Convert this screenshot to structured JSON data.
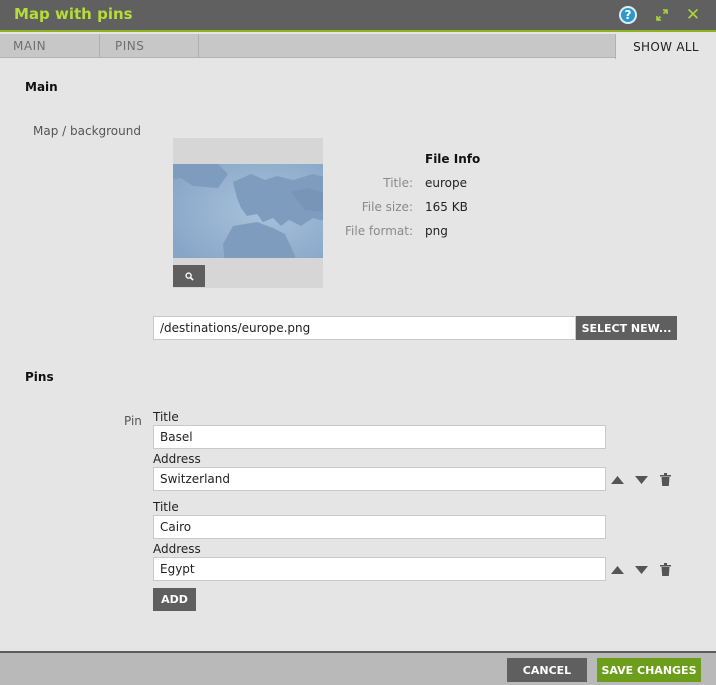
{
  "window": {
    "title": "Map with pins",
    "help_icon": "help-icon",
    "help_glyph": "?",
    "expand_icon": "expand-icon",
    "close_icon": "close-icon",
    "close_glyph": "✕",
    "accent_color": "#8cb21f"
  },
  "tabs": {
    "main": "MAIN",
    "pins": "PINS",
    "show_all": "SHOW ALL"
  },
  "main_section": {
    "heading": "Main",
    "map_label": "Map / background",
    "zoom_icon": "magnifier-icon",
    "file_info": {
      "title": "File Info",
      "rows": [
        {
          "label": "Title:",
          "value": "europe"
        },
        {
          "label": "File size:",
          "value": "165 KB"
        },
        {
          "label": "File format:",
          "value": "png"
        }
      ]
    },
    "file_path": "/destinations/europe.png",
    "select_button": "SELECT NEW..."
  },
  "pins_section": {
    "heading": "Pins",
    "pin_label": "Pin",
    "title_label": "Title",
    "address_label": "Address",
    "pins": [
      {
        "title": "Basel",
        "address": "Switzerland"
      },
      {
        "title": "Cairo",
        "address": "Egypt"
      }
    ],
    "move_up_icon": "arrow-up-icon",
    "move_down_icon": "arrow-down-icon",
    "delete_icon": "trash-icon",
    "add_button": "ADD"
  },
  "footer": {
    "cancel": "CANCEL",
    "save": "SAVE CHANGES",
    "save_color": "#6d9e1b"
  }
}
